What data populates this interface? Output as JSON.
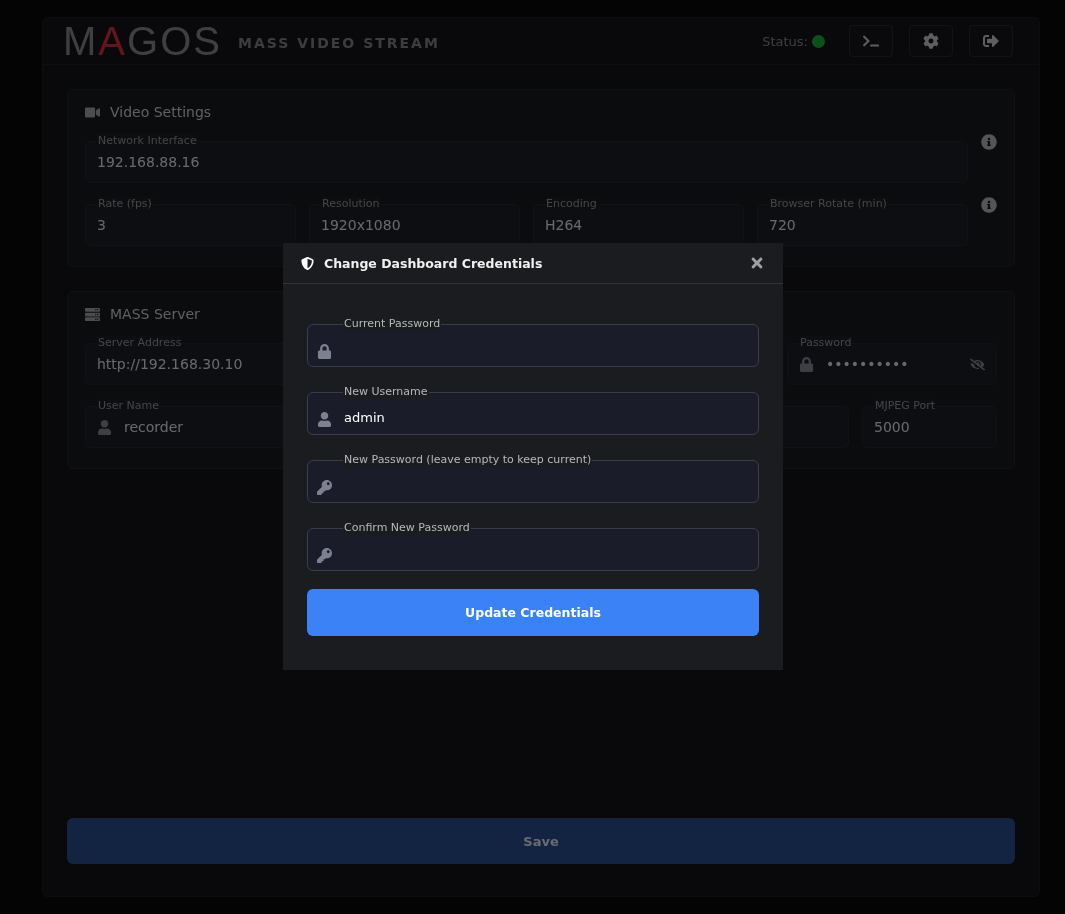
{
  "header": {
    "logo": "MAGOS",
    "subtitle": "MASS VIDEO STREAM",
    "status_label": "Status:",
    "online": true
  },
  "video_settings": {
    "title": "Video Settings",
    "network_interface": {
      "label": "Network Interface",
      "value": "192.168.88.16"
    },
    "fields": [
      {
        "label": "Rate (fps)",
        "value": "3"
      },
      {
        "label": "Resolution",
        "value": "1920x1080"
      },
      {
        "label": "Encoding",
        "value": "H264"
      },
      {
        "label": "Browser Rotate (min)",
        "value": "720"
      }
    ]
  },
  "mass_server": {
    "title": "MASS Server",
    "server_address": {
      "label": "Server Address",
      "value": "http://192.168.30.10"
    },
    "password": {
      "label": "Password",
      "value": "••••••••••"
    },
    "user_name": {
      "label": "User Name",
      "value": "recorder"
    },
    "mjpeg_port": {
      "label": "MJPEG Port",
      "value": "5000"
    }
  },
  "save_button": "Save",
  "dialog": {
    "title": "Change Dashboard Credentials",
    "fields": [
      {
        "label": "Current Password",
        "kind": "lock"
      },
      {
        "label": "New Username",
        "kind": "user",
        "value": "admin"
      },
      {
        "label": "New Password (leave empty to keep current)",
        "kind": "key"
      },
      {
        "label": "Confirm New Password",
        "kind": "key"
      }
    ],
    "submit": "Update Credentials"
  }
}
